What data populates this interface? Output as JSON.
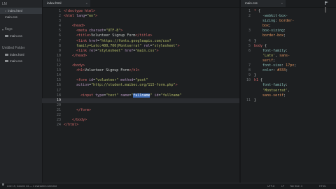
{
  "sidebar": {
    "header": "LM",
    "section1_files": [
      {
        "name": "index.html",
        "active": true
      },
      {
        "name": "main.css",
        "active": false
      }
    ],
    "folder_label": "flags",
    "section2_files": [
      {
        "name": "main.css"
      }
    ],
    "section3_header": "Untitled Folder",
    "section3_files": [
      {
        "name": "index.html"
      },
      {
        "name": "main.css"
      }
    ]
  },
  "tabs": {
    "left": "index.html",
    "right": "main.css",
    "close": "×"
  },
  "editor_left": {
    "line_numbers": [
      "1",
      "2",
      "3",
      "4",
      "5",
      "6",
      "7",
      "8",
      "9",
      "10",
      "11",
      "12",
      "13",
      "14",
      "15",
      "16",
      "17",
      "18",
      "19",
      "20",
      "21",
      "22",
      "23",
      "24"
    ],
    "current_line": "19",
    "lines": [
      [
        [
          "t",
          "<!doctype html>"
        ]
      ],
      [
        [
          "t",
          "<html "
        ],
        [
          "a",
          "lang"
        ],
        [
          "w",
          "="
        ],
        [
          "s",
          "\"en\""
        ],
        [
          "t",
          ">"
        ]
      ],
      [],
      [
        [
          "w",
          "    "
        ],
        [
          "t",
          "<head>"
        ]
      ],
      [
        [
          "w",
          "      "
        ],
        [
          "t",
          "<meta "
        ],
        [
          "a",
          "charset"
        ],
        [
          "w",
          "="
        ],
        [
          "s",
          "\"UTF-8\""
        ],
        [
          "t",
          ">"
        ]
      ],
      [
        [
          "w",
          "      "
        ],
        [
          "t",
          "<title>"
        ],
        [
          "w",
          "Volunteer Signup Form"
        ],
        [
          "t",
          "</title>"
        ]
      ],
      [
        [
          "w",
          "      "
        ],
        [
          "t",
          "<link "
        ],
        [
          "a",
          "href"
        ],
        [
          "w",
          "="
        ],
        [
          "s",
          "\"https://fonts.googleapis.com/css?"
        ]
      ],
      [
        [
          "s",
          "      family=Lato:400,700|Montserrat\" "
        ],
        [
          "a",
          "rel"
        ],
        [
          "w",
          "="
        ],
        [
          "s",
          "\"stylesheet\""
        ],
        [
          "t",
          ">"
        ]
      ],
      [
        [
          "w",
          "      "
        ],
        [
          "t",
          "<link "
        ],
        [
          "a",
          "rel"
        ],
        [
          "w",
          "="
        ],
        [
          "s",
          "\"stylesheet\" "
        ],
        [
          "a",
          "href"
        ],
        [
          "w",
          "="
        ],
        [
          "s",
          "\"main.css\""
        ],
        [
          "t",
          ">"
        ]
      ],
      [
        [
          "w",
          "    "
        ],
        [
          "t",
          "</head>"
        ]
      ],
      [],
      [
        [
          "w",
          "    "
        ],
        [
          "t",
          "<body>"
        ]
      ],
      [
        [
          "w",
          "      "
        ],
        [
          "t",
          "<h1>"
        ],
        [
          "w",
          "Volunteer Signup Form"
        ],
        [
          "t",
          "</h1>"
        ]
      ],
      [],
      [
        [
          "w",
          "      "
        ],
        [
          "t",
          "<form "
        ],
        [
          "a",
          "id"
        ],
        [
          "w",
          "="
        ],
        [
          "s",
          "\"volunteer\" "
        ],
        [
          "a",
          "method"
        ],
        [
          "w",
          "="
        ],
        [
          "s",
          "\"post\""
        ]
      ],
      [
        [
          "w",
          "      "
        ],
        [
          "a",
          "action"
        ],
        [
          "w",
          "="
        ],
        [
          "s",
          "\"http://student.maibec.org/115-form.php\""
        ],
        [
          "t",
          ">"
        ]
      ],
      [],
      [
        [
          "w",
          "        "
        ],
        [
          "t",
          "<input "
        ],
        [
          "a",
          "type"
        ],
        [
          "w",
          "="
        ],
        [
          "s",
          "\"text\" "
        ],
        [
          "a",
          "name"
        ],
        [
          "w",
          "="
        ],
        [
          "s",
          "\""
        ],
        [
          "sel",
          "fullname"
        ],
        [
          "s",
          "\" "
        ],
        [
          "a",
          "id"
        ],
        [
          "w",
          "="
        ],
        [
          "s",
          "\"fullname\""
        ]
      ],
      [],
      [],
      [
        [
          "w",
          "      "
        ],
        [
          "t",
          "</form>"
        ]
      ],
      [],
      [
        [
          "w",
          "    "
        ],
        [
          "t",
          "</body>"
        ]
      ],
      [
        [
          "t",
          "</html>"
        ]
      ]
    ]
  },
  "editor_right": {
    "line_numbers": [
      "1",
      "2",
      "3",
      "4",
      "5",
      "6",
      "7",
      "8",
      "9",
      "10",
      "11",
      "12",
      "13",
      "14",
      "15",
      "16"
    ],
    "lines": [
      [
        [
          "t",
          "* "
        ],
        [
          "w",
          "{"
        ]
      ],
      [
        [
          "w",
          "    "
        ],
        [
          "p",
          "-webkit-box-"
        ]
      ],
      [
        [
          "w",
          "    "
        ],
        [
          "p",
          "sizing"
        ],
        [
          "w",
          ": "
        ],
        [
          "k",
          "border-"
        ]
      ],
      [
        [
          "w",
          "    "
        ],
        [
          "k",
          "box"
        ],
        [
          "w",
          ";"
        ]
      ],
      [
        [
          "w",
          "    "
        ],
        [
          "p",
          "box-sizing"
        ],
        [
          "w",
          ":"
        ]
      ],
      [
        [
          "w",
          "    "
        ],
        [
          "k",
          "border-box"
        ],
        [
          "w",
          ";"
        ]
      ],
      [
        [
          "w",
          "}"
        ]
      ],
      [
        [
          "t",
          "body "
        ],
        [
          "w",
          "{"
        ]
      ],
      [
        [
          "w",
          "    "
        ],
        [
          "p",
          "font-family"
        ],
        [
          "w",
          ":"
        ]
      ],
      [
        [
          "w",
          "    "
        ],
        [
          "s",
          "'Lato'"
        ],
        [
          "w",
          ", "
        ],
        [
          "k",
          "sans-"
        ]
      ],
      [
        [
          "w",
          "    "
        ],
        [
          "k",
          "serif"
        ],
        [
          "w",
          ";"
        ]
      ],
      [
        [
          "w",
          "    "
        ],
        [
          "p",
          "font-size"
        ],
        [
          "w",
          ": "
        ],
        [
          "k",
          "17px"
        ],
        [
          "w",
          ";"
        ]
      ],
      [
        [
          "w",
          "    "
        ],
        [
          "p",
          "color"
        ],
        [
          "w",
          ": "
        ],
        [
          "k",
          "#333"
        ],
        [
          "w",
          ";"
        ]
      ],
      [
        [
          "w",
          "}"
        ]
      ],
      [
        [
          "t",
          "h1 "
        ],
        [
          "w",
          "{"
        ]
      ],
      [
        [
          "w",
          "    "
        ],
        [
          "p",
          "font-family"
        ],
        [
          "w",
          ":"
        ]
      ],
      [
        [
          "w",
          "    "
        ],
        [
          "s",
          "'Montserrat'"
        ],
        [
          "w",
          ","
        ]
      ],
      [
        [
          "w",
          "    "
        ],
        [
          "k",
          "sans-serif"
        ],
        [
          "w",
          ";"
        ]
      ],
      [
        [
          "w",
          "}"
        ]
      ]
    ],
    "gutter_map": [
      "1",
      "2",
      "",
      "",
      "3",
      "",
      "4",
      "5",
      "6",
      "",
      "",
      "7",
      "8",
      "9",
      "10",
      "",
      "",
      "",
      "11"
    ]
  },
  "statusbar": {
    "left": "Line 19, Column 44 — 4 characters selected",
    "encoding": "UTF-8",
    "line_endings": "LF",
    "tab_size": "Tab Size: 4",
    "syntax": "HTML"
  }
}
